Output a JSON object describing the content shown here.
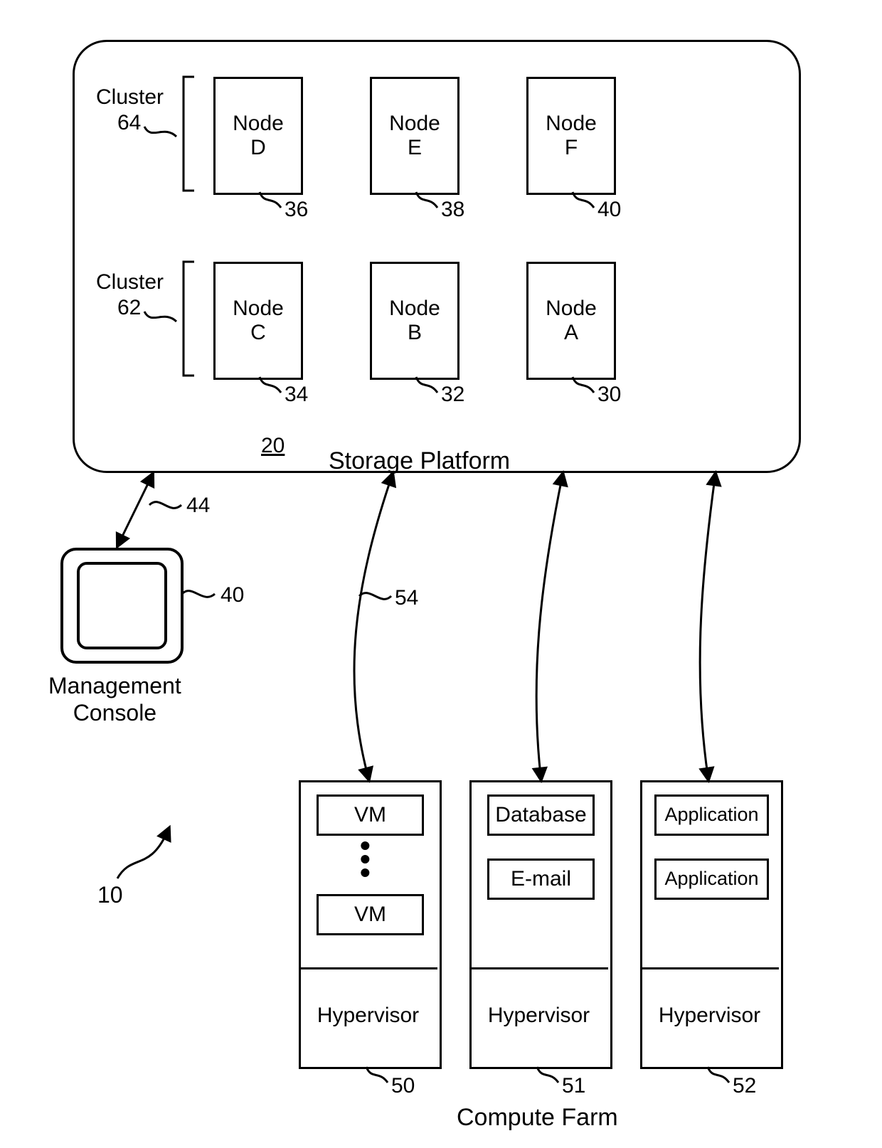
{
  "diagram": {
    "title_number": "10",
    "storage_platform": {
      "label": "Storage Platform",
      "id": "20",
      "clusters": [
        {
          "name": "Cluster",
          "id": "64",
          "nodes": [
            {
              "label": "Node\nD",
              "ref": "36"
            },
            {
              "label": "Node\nE",
              "ref": "38"
            },
            {
              "label": "Node\nF",
              "ref": "40"
            }
          ]
        },
        {
          "name": "Cluster",
          "id": "62",
          "nodes": [
            {
              "label": "Node\nC",
              "ref": "34"
            },
            {
              "label": "Node\nB",
              "ref": "32"
            },
            {
              "label": "Node\nA",
              "ref": "30"
            }
          ]
        }
      ]
    },
    "management_console": {
      "label": "Management\nConsole",
      "ref": "40",
      "link_ref": "44"
    },
    "compute_farm": {
      "label": "Compute Farm",
      "link_ref": "54",
      "servers": [
        {
          "ref": "50",
          "top_boxes": [
            "VM",
            "VM"
          ],
          "ellipsis": true,
          "bottom": "Hypervisor"
        },
        {
          "ref": "51",
          "top_boxes": [
            "Database",
            "E-mail"
          ],
          "ellipsis": false,
          "bottom": "Hypervisor"
        },
        {
          "ref": "52",
          "top_boxes": [
            "Application",
            "Application"
          ],
          "ellipsis": false,
          "bottom": "Hypervisor"
        }
      ]
    }
  }
}
